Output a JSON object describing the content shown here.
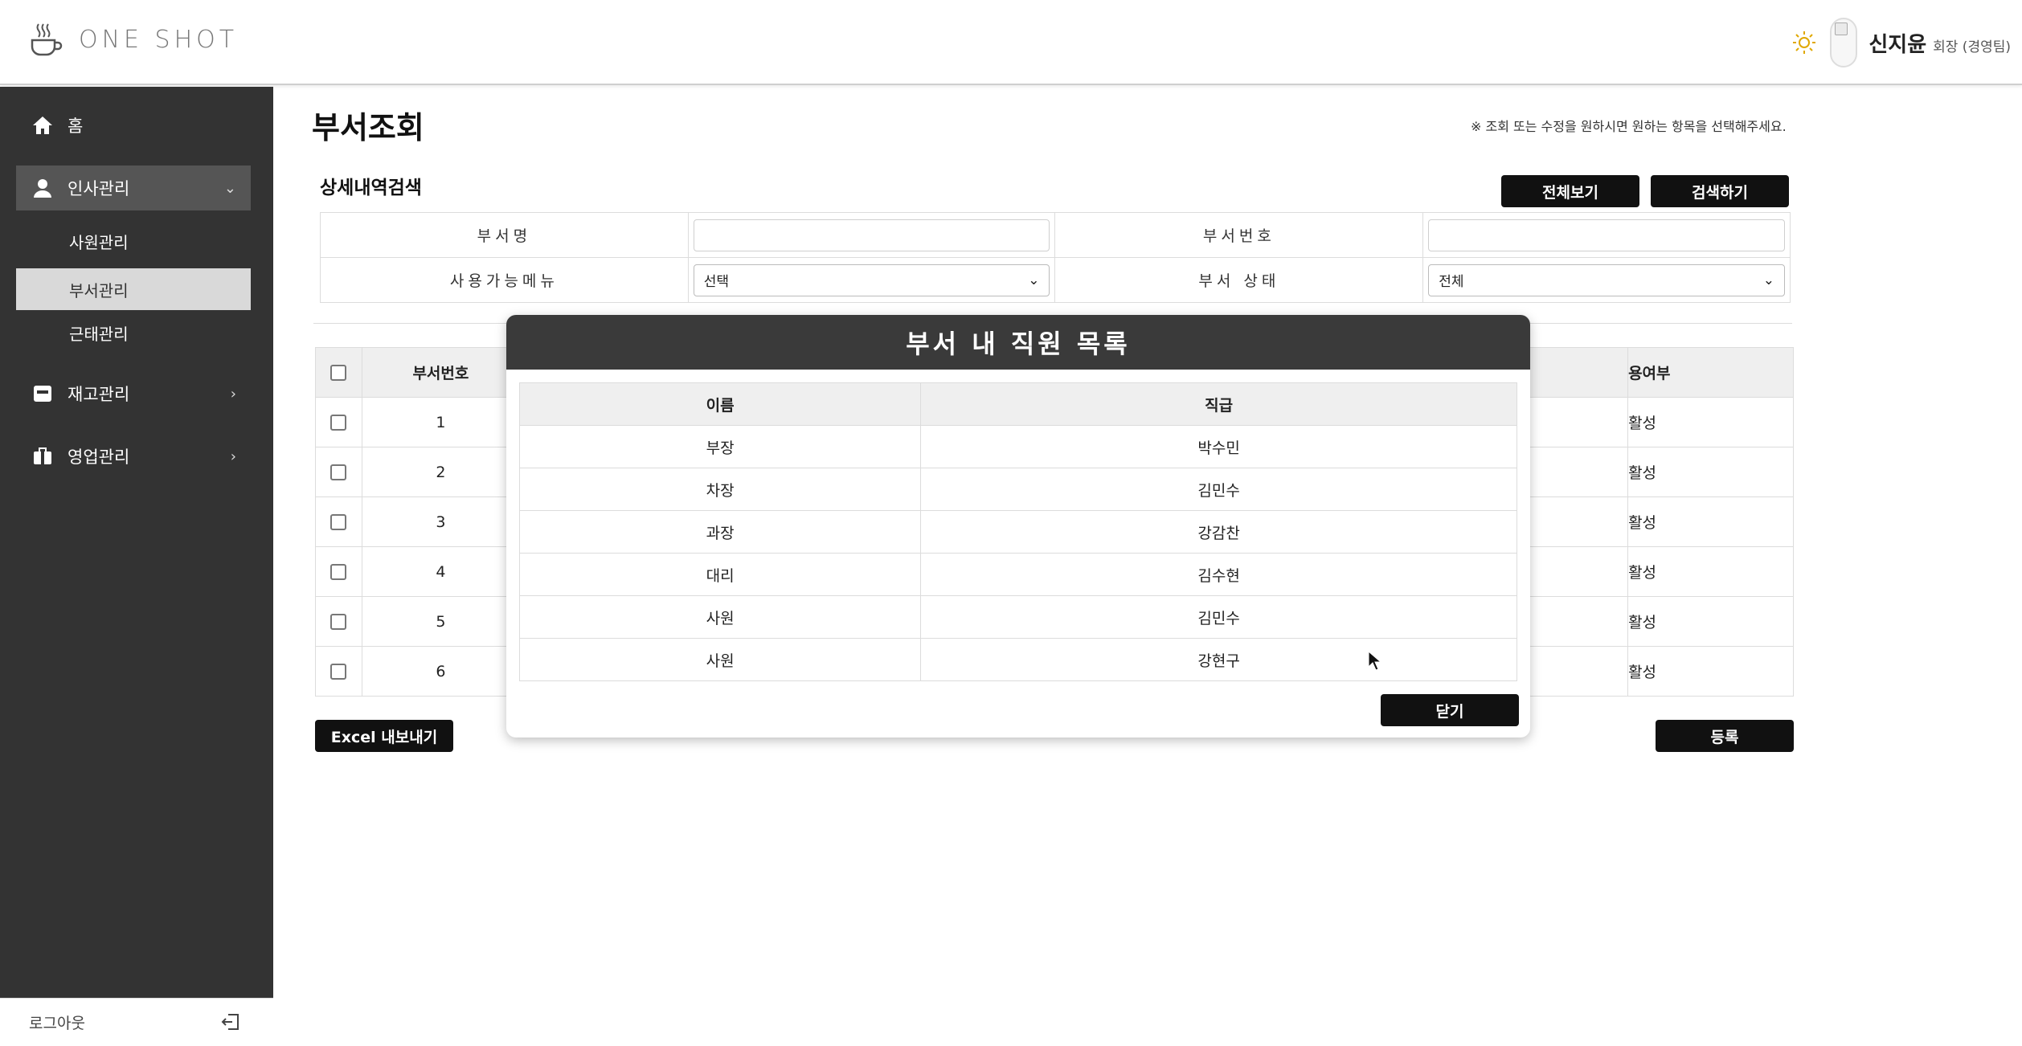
{
  "header": {
    "logo_text": "ONE SHOT",
    "user_name": "신지윤",
    "user_role": "회장 (경영팀)"
  },
  "sidebar": {
    "items": [
      {
        "label": "홈",
        "icon": "home-icon"
      },
      {
        "label": "인사관리",
        "icon": "person-icon",
        "expanded": true
      },
      {
        "label": "재고관리",
        "icon": "inbox-icon"
      },
      {
        "label": "영업관리",
        "icon": "briefcase-icon"
      }
    ],
    "sub_items": [
      {
        "label": "사원관리"
      },
      {
        "label": "부서관리",
        "selected": true
      },
      {
        "label": "근태관리"
      }
    ],
    "logout_label": "로그아웃"
  },
  "page": {
    "title": "부서조회",
    "note": "※ 조회 또는 수정을 원하시면 원하는 항목을 선택해주세요.",
    "section_title": "상세내역검색",
    "btn_view_all": "전체보기",
    "btn_search": "검색하기",
    "btn_export": "Excel 내보내기",
    "btn_register": "등록"
  },
  "search": {
    "dept_name_label": "부서명",
    "dept_no_label": "부서번호",
    "menu_label": "사용가능메뉴",
    "menu_value": "선택",
    "status_label": "부서 상태",
    "status_value": "전체"
  },
  "results": {
    "headers": [
      "부서번호",
      "사용여부"
    ],
    "header_second_visible": "용여부",
    "rows": [
      {
        "no": "1",
        "status": "활성"
      },
      {
        "no": "2",
        "status": "활성"
      },
      {
        "no": "3",
        "status": "활성"
      },
      {
        "no": "4",
        "status": "활성"
      },
      {
        "no": "5",
        "status": "활성"
      },
      {
        "no": "6",
        "status": "활성"
      }
    ]
  },
  "modal": {
    "title": "부서 내 직원 목록",
    "col_name": "이름",
    "col_rank": "직급",
    "rows": [
      {
        "name": "부장",
        "rank": "박수민"
      },
      {
        "name": "차장",
        "rank": "김민수"
      },
      {
        "name": "과장",
        "rank": "강감찬"
      },
      {
        "name": "대리",
        "rank": "김수현"
      },
      {
        "name": "사원",
        "rank": "김민수"
      },
      {
        "name": "사원",
        "rank": "강현구"
      }
    ],
    "close_label": "닫기"
  }
}
